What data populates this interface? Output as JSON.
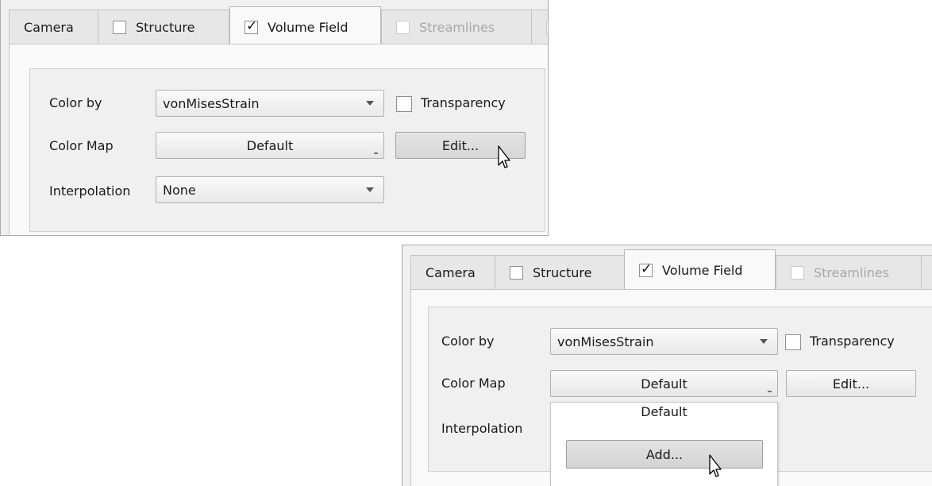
{
  "tabs": {
    "camera": "Camera",
    "structure": "Structure",
    "volume_field": "Volume Field",
    "streamlines": "Streamlines"
  },
  "fields": {
    "color_by_label": "Color by",
    "color_by_value": "vonMisesStrain",
    "transparency_label": "Transparency",
    "color_map_label": "Color Map",
    "color_map_value": "Default",
    "edit_button": "Edit...",
    "interpolation_label": "Interpolation",
    "interpolation_value": "None"
  },
  "dropdown": {
    "header": "Default",
    "add_button": "Add..."
  },
  "checkbox_states": {
    "structure": false,
    "volume_field": true,
    "streamlines": false,
    "transparency": false
  },
  "icons": {
    "check": "checkmark-icon",
    "dropdown": "dropdown-arrow-icon",
    "cursor": "mouse-pointer-icon"
  }
}
